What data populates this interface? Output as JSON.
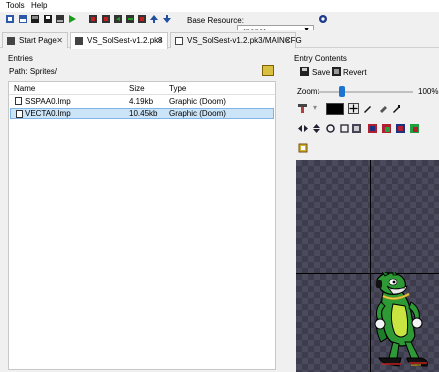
{
  "menu": {
    "tools": "Tools",
    "help": "Help"
  },
  "toolbar": {
    "base_resource_label": "Base Resource:",
    "base_resource_value": "<none>"
  },
  "tabs": [
    {
      "label": "Start Page"
    },
    {
      "label": "VS_SolSest-v1.2.pk3"
    },
    {
      "label": "VS_SolSest-v1.2.pk3/MAINCFG"
    }
  ],
  "entries": {
    "title": "Entries",
    "path": "Path: Sprites/",
    "columns": [
      "Name",
      "Size",
      "Type"
    ],
    "rows": [
      {
        "name": "SSPAA0.lmp",
        "size": "4.19kb",
        "type": "Graphic (Doom)"
      },
      {
        "name": "VECTA0.lmp",
        "size": "10.45kb",
        "type": "Graphic (Doom)"
      }
    ]
  },
  "entry_contents": {
    "title": "Entry Contents",
    "save_label": "Save",
    "revert_label": "Revert",
    "zoom_label": "Zoom:",
    "zoom_value": "100%",
    "zoom_fraction": 0.22
  },
  "colors": {
    "accent": "#1e74d0",
    "selection_bg": "#cce4f7",
    "canvas_bg": "#4a4a5c"
  }
}
